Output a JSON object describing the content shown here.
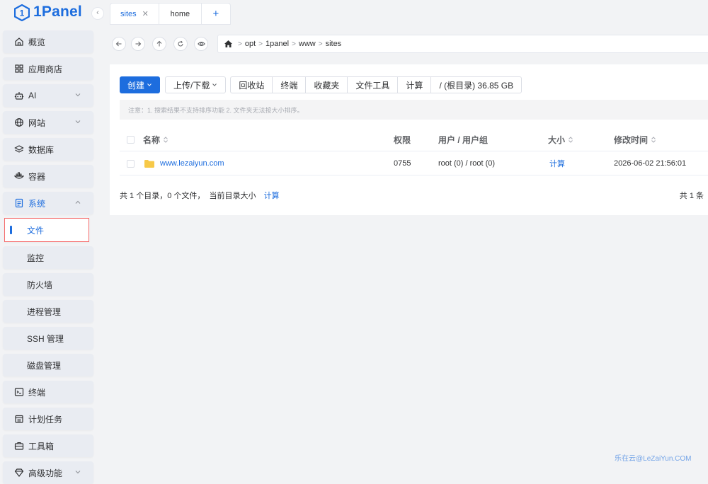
{
  "brand": {
    "name": "1Panel"
  },
  "sidebar": {
    "items": [
      {
        "label": "概览",
        "icon": "home-icon"
      },
      {
        "label": "应用商店",
        "icon": "grid-icon"
      },
      {
        "label": "AI",
        "icon": "robot-icon"
      },
      {
        "label": "网站",
        "icon": "globe-icon"
      },
      {
        "label": "数据库",
        "icon": "database-icon"
      },
      {
        "label": "容器",
        "icon": "container-icon"
      },
      {
        "label": "系统",
        "icon": "system-icon"
      },
      {
        "label": "文件"
      },
      {
        "label": "监控"
      },
      {
        "label": "防火墙"
      },
      {
        "label": "进程管理"
      },
      {
        "label": "SSH 管理"
      },
      {
        "label": "磁盘管理"
      },
      {
        "label": "终端",
        "icon": "terminal-icon"
      },
      {
        "label": "计划任务",
        "icon": "calendar-icon"
      },
      {
        "label": "工具箱",
        "icon": "toolbox-icon"
      },
      {
        "label": "高级功能",
        "icon": "diamond-icon"
      }
    ]
  },
  "tabs": [
    {
      "label": "sites",
      "active": true
    },
    {
      "label": "home",
      "active": false
    }
  ],
  "path": {
    "segments": [
      "opt",
      "1panel",
      "www",
      "sites"
    ]
  },
  "toolbar": {
    "create": "创建",
    "upload_download": "上传/下载",
    "group": [
      "回收站",
      "终端",
      "收藏夹",
      "文件工具",
      "计算"
    ],
    "disk": "/ (根目录) 36.85 GB"
  },
  "notice": "注意：1. 搜索结果不支持排序功能 2. 文件夹无法按大小排序。",
  "table": {
    "headers": {
      "name": "名称",
      "perm": "权限",
      "user": "用户 / 用户组",
      "size": "大小",
      "mtime": "修改时间"
    },
    "rows": [
      {
        "name": "www.lezaiyun.com",
        "perm": "0755",
        "user": "root (0) / root (0)",
        "size": "计算",
        "mtime": "2026-06-02 21:56:01"
      }
    ]
  },
  "footer": {
    "summary": "共 1 个目录，0 个文件，  当前目录大小",
    "calc": "计算",
    "total": "共 1 条"
  },
  "watermark": "乐在云@LeZaiYun.COM",
  "colors": {
    "primary": "#1d6dde",
    "folder": "#f7c948",
    "highlight_border": "#f56c6c"
  }
}
